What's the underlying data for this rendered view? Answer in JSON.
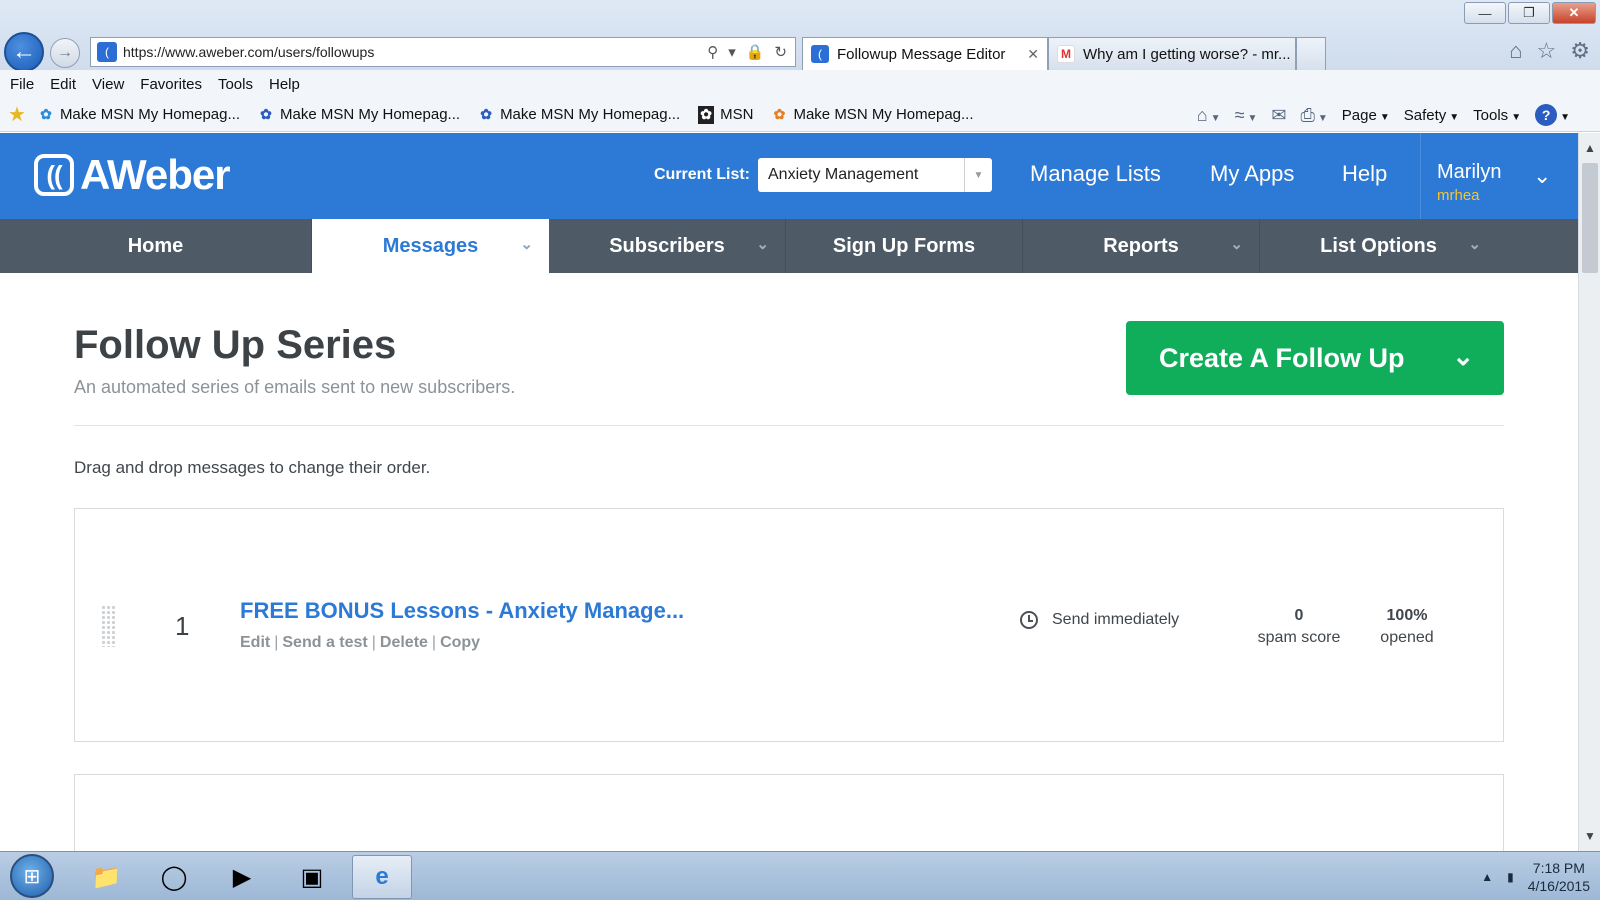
{
  "browser": {
    "address_url": "https://www.aweber.com/users/followups",
    "tabs": [
      {
        "title": "Followup Message Editor"
      },
      {
        "title": "Why am I getting worse? - mr..."
      }
    ],
    "menu": [
      "File",
      "Edit",
      "View",
      "Favorites",
      "Tools",
      "Help"
    ],
    "favorites": [
      {
        "label": "Make MSN My Homepag...",
        "icon": "msn-butterfly-icon"
      },
      {
        "label": "Make MSN My Homepag...",
        "icon": "msn-butterfly-icon"
      },
      {
        "label": "Make MSN My Homepag...",
        "icon": "msn-butterfly-icon"
      },
      {
        "label": "MSN",
        "icon": "msn-icon"
      },
      {
        "label": "Make MSN My Homepag...",
        "icon": "msn-butterfly-icon"
      }
    ],
    "command_bar": {
      "page": "Page",
      "safety": "Safety",
      "tools": "Tools"
    }
  },
  "aweber": {
    "logo": "AWeber",
    "current_list_label": "Current List:",
    "current_list_value": "Anxiety Management",
    "top_links": [
      "Manage Lists",
      "My Apps",
      "Help"
    ],
    "user": {
      "name": "Marilyn",
      "handle": "mrhea"
    },
    "nav": [
      {
        "label": "Home",
        "active": false
      },
      {
        "label": "Messages",
        "active": true
      },
      {
        "label": "Subscribers",
        "active": false
      },
      {
        "label": "Sign Up Forms",
        "active": false
      },
      {
        "label": "Reports",
        "active": false
      },
      {
        "label": "List Options",
        "active": false
      }
    ],
    "colors": {
      "header": "#2c7ad6",
      "nav": "#4e5b67",
      "create_button": "#10ad5b",
      "user_handle": "#f5c531"
    }
  },
  "page": {
    "title": "Follow Up Series",
    "subtitle": "An automated series of emails sent to new subscribers.",
    "create_button": "Create A Follow Up",
    "drag_hint": "Drag and drop messages to change their order."
  },
  "messages": [
    {
      "number": "1",
      "title": "FREE BONUS Lessons - Anxiety Manage...",
      "actions": [
        "Edit",
        "Send a test",
        "Delete",
        "Copy"
      ],
      "schedule": "Send immediately",
      "spam_score_value": "0",
      "spam_score_label": "spam score",
      "opened_value": "100%",
      "opened_label": "opened"
    }
  ],
  "taskbar": {
    "time": "7:18 PM",
    "date": "4/16/2015"
  }
}
